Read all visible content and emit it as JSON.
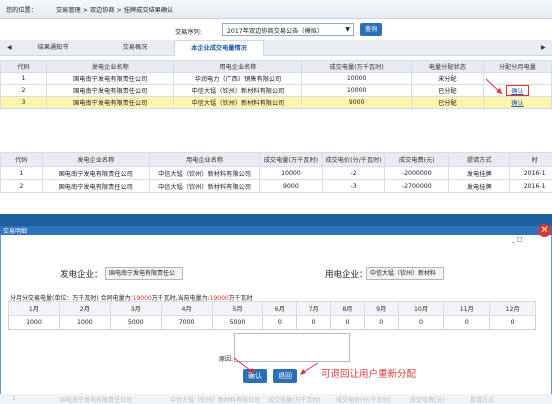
{
  "breadcrumb": {
    "location_label": "您的位置：",
    "path": "交易管理 > 双边协商 > 挂牌成交结果确认"
  },
  "query": {
    "label": "交易序列:",
    "selected": "2017年双边协商交易公告（模拟）",
    "button": "查询"
  },
  "tabs": [
    {
      "label": "结果通知书",
      "active": false
    },
    {
      "label": "交易概况",
      "active": false
    },
    {
      "label": "本企业成交电量情况",
      "active": true
    }
  ],
  "table1": {
    "headers": [
      "代码",
      "发电企业名称",
      "用电企业名称",
      "成交电量(万千瓦时)",
      "电量分配状态",
      "分配分月电量"
    ],
    "rows": [
      {
        "code": "1",
        "seller": "国电南宁发电有限责任公司",
        "buyer": "华润电力（广西）销售有限公司",
        "volume": "10000",
        "status": "未分配",
        "action": ""
      },
      {
        "code": "2",
        "seller": "国电南宁发电有限责任公司",
        "buyer": "中信大锰（钦州）新材料有限公司",
        "volume": "10000",
        "status": "已分配",
        "action": "确认"
      },
      {
        "code": "3",
        "seller": "国电南宁发电有限责任公司",
        "buyer": "中信大锰（钦州）新材料有限公司",
        "volume": "9000",
        "status": "已分配",
        "action": "确认"
      }
    ]
  },
  "table2": {
    "headers": [
      "代码",
      "发电企业名称",
      "用电企业名称",
      "成交电量(万千瓦时)",
      "成交电价(分/千瓦时)",
      "成交电费(元)",
      "提请方式",
      "时"
    ],
    "rows": [
      [
        "1",
        "国电南宁发电有限责任公司",
        "中信大锰（钦州）新材料有限公司",
        "10000",
        "-2",
        "-2000000",
        "发电挂牌",
        "2016-1"
      ],
      [
        "2",
        "国电南宁发电有限责任公司",
        "中信大锰（钦州）新材料有限公司",
        "9000",
        "-3",
        "-2700000",
        "发电挂牌",
        "2016-1"
      ]
    ]
  },
  "modal": {
    "title": "交易明细",
    "win_controls": "_ □",
    "seller_label": "发电企业：",
    "seller_value": "国电南宁发电有限责任公",
    "buyer_label": "用电企业：",
    "buyer_value": "中信大锰（钦州）新材料",
    "summary_prefix": "分月分交易电量(单位：万千瓦时) 合同电量为:",
    "contract_volume": "19000",
    "summary_mid": "万千瓦时,当前电量为:",
    "current_volume": "19000",
    "summary_suffix": "万千瓦时",
    "months": [
      "1月",
      "2月",
      "3月",
      "4月",
      "5月",
      "6月",
      "7月",
      "8月",
      "9月",
      "10月",
      "11月",
      "12月"
    ],
    "values": [
      "1000",
      "1000",
      "5000",
      "7000",
      "5000",
      "0",
      "0",
      "0",
      "0",
      "0",
      "0",
      "0"
    ],
    "reason_label": "原因:",
    "confirm_button": "确认",
    "back_button": "退回",
    "annotation": "可退回让用户重新分配"
  },
  "ghost_row": [
    "1",
    "国电南宁发电有限责任公司",
    "中信大锰（钦州）新材料有限公司",
    "成交电量(万千瓦时)",
    "成交电价(分/千瓦时)",
    "成交电费(元)",
    "提请方式"
  ],
  "colors": {
    "accent": "#2b6fb8",
    "highlight_row": "#fff3b0",
    "annotation": "#e03a3a",
    "close": "#d83a2f"
  }
}
